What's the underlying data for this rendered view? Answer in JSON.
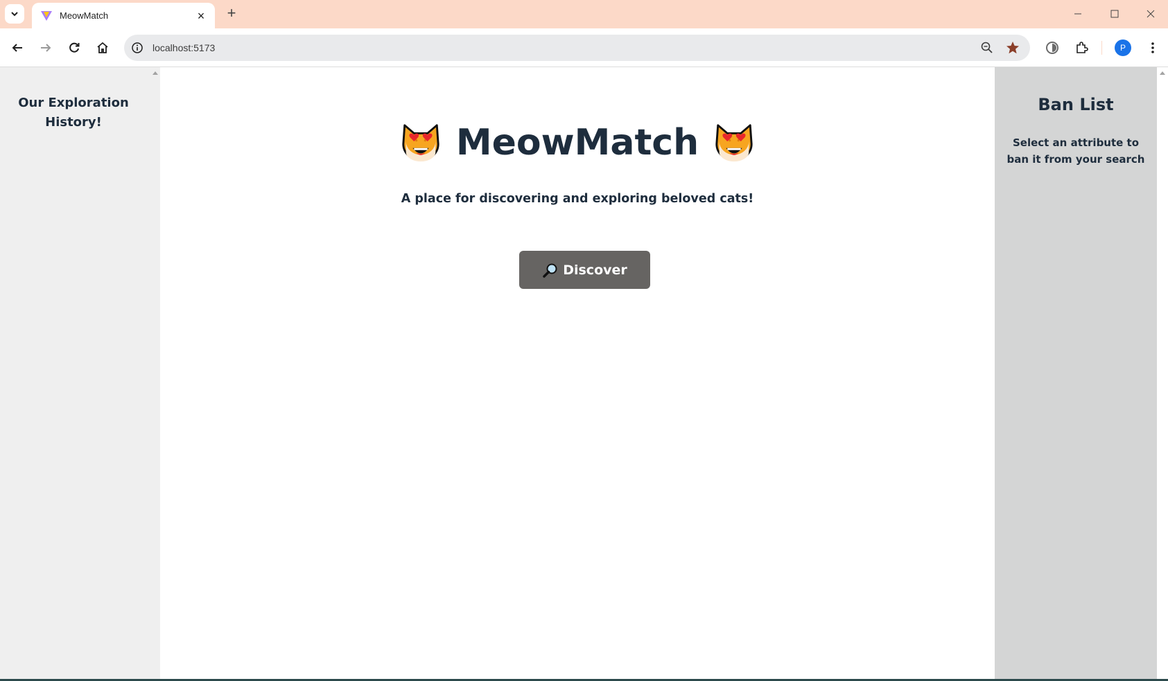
{
  "browser": {
    "tab_title": "MeowMatch",
    "url": "localhost:5173",
    "profile_initial": "P",
    "new_tab_symbol": "+",
    "tab_close_symbol": "×",
    "accent_color": "#fcd9c8"
  },
  "sidebar_left": {
    "title": "Our Exploration History!"
  },
  "main": {
    "title": "MeowMatch",
    "title_icon": "smiling-cat-with-heart-eyes-icon",
    "subtitle": "A place for discovering and exploring beloved cats!",
    "discover_label": "Discover",
    "discover_icon": "magnifying-glass-icon"
  },
  "sidebar_right": {
    "title": "Ban List",
    "subtitle": "Select an attribute to ban it from your search"
  }
}
